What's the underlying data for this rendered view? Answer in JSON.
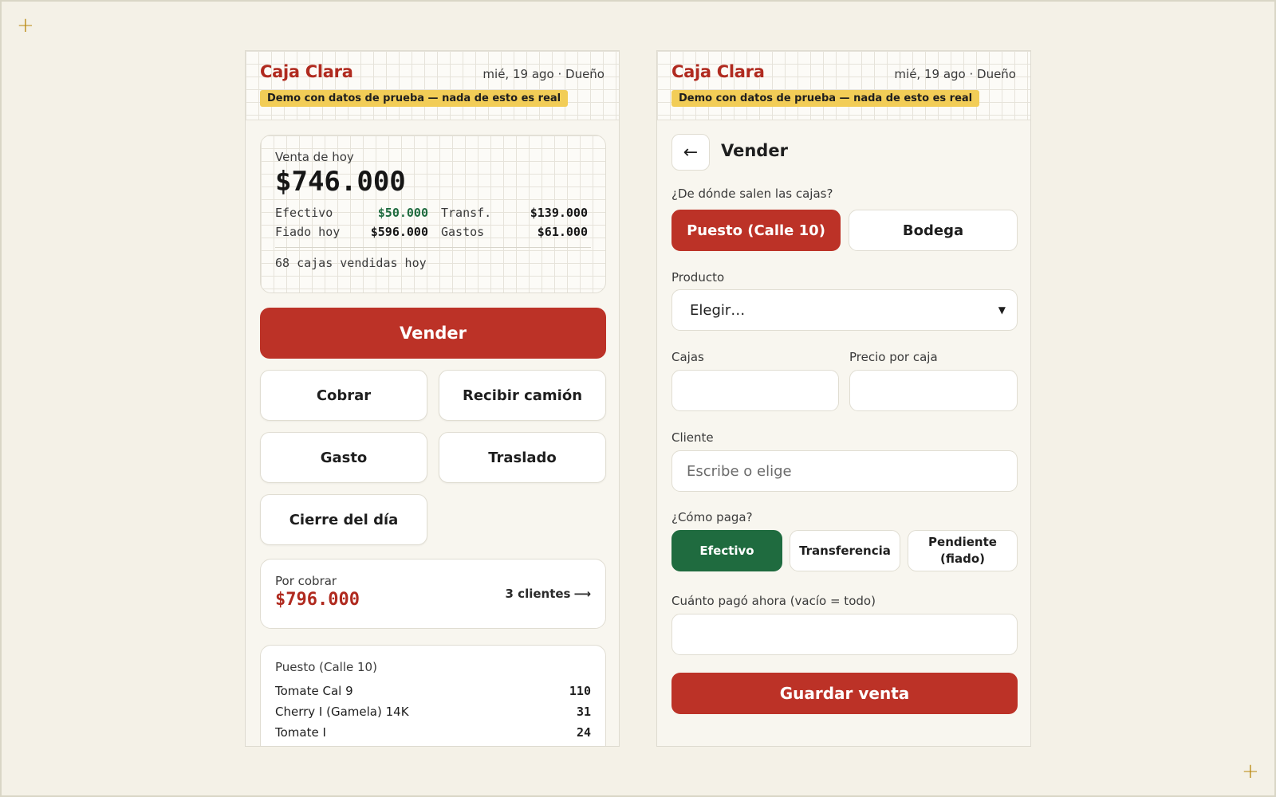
{
  "app": {
    "brand": "Caja Clara",
    "header_meta": "mié, 19 ago · Dueño",
    "demo_badge": "Demo con datos de prueba — nada de esto es real"
  },
  "home": {
    "summary": {
      "label": "Venta de hoy",
      "total": "$746.000",
      "stats": [
        {
          "label": "Efectivo",
          "value": "$50.000"
        },
        {
          "label": "Transf.",
          "value": "$139.000"
        },
        {
          "label": "Fiado hoy",
          "value": "$596.000"
        },
        {
          "label": "Gastos",
          "value": "$61.000"
        }
      ],
      "boxes_sold": "68 cajas vendidas hoy"
    },
    "actions": {
      "sell": "Vender",
      "collect": "Cobrar",
      "receive_truck": "Recibir camión",
      "expense": "Gasto",
      "transfer": "Traslado",
      "close_day": "Cierre del día"
    },
    "receivable": {
      "label": "Por cobrar",
      "amount": "$796.000",
      "link": "3 clientes",
      "link_arrow": "⟶"
    },
    "stock": {
      "location": "Puesto (Calle 10)",
      "items": [
        {
          "name": "Tomate Cal 9",
          "qty": "110"
        },
        {
          "name": "Cherry I (Gamela) 14K",
          "qty": "31"
        },
        {
          "name": "Tomate I",
          "qty": "24"
        }
      ]
    }
  },
  "sell": {
    "back_icon": "←",
    "title": "Vender",
    "source_label": "¿De dónde salen las cajas?",
    "source_options": [
      "Puesto (Calle 10)",
      "Bodega"
    ],
    "product_label": "Producto",
    "product_selected": "Elegir…",
    "boxes_label": "Cajas",
    "price_label": "Precio por caja",
    "client_label": "Cliente",
    "client_placeholder": "Escribe o elige",
    "payment_label": "¿Cómo paga?",
    "payment_options": [
      "Efectivo",
      "Transferencia",
      "Pendiente (fiado)"
    ],
    "paid_now_label": "Cuánto pagó ahora (vacío = todo)",
    "save_label": "Guardar venta"
  },
  "colors": {
    "accent_red": "#bc3227",
    "brand_red": "#b02a1f",
    "cash_green": "#1f6b3f",
    "demo_yellow": "#f2cd57"
  },
  "icons": {
    "corner_marks": "+",
    "select_chevron": "chevron-down-icon"
  }
}
